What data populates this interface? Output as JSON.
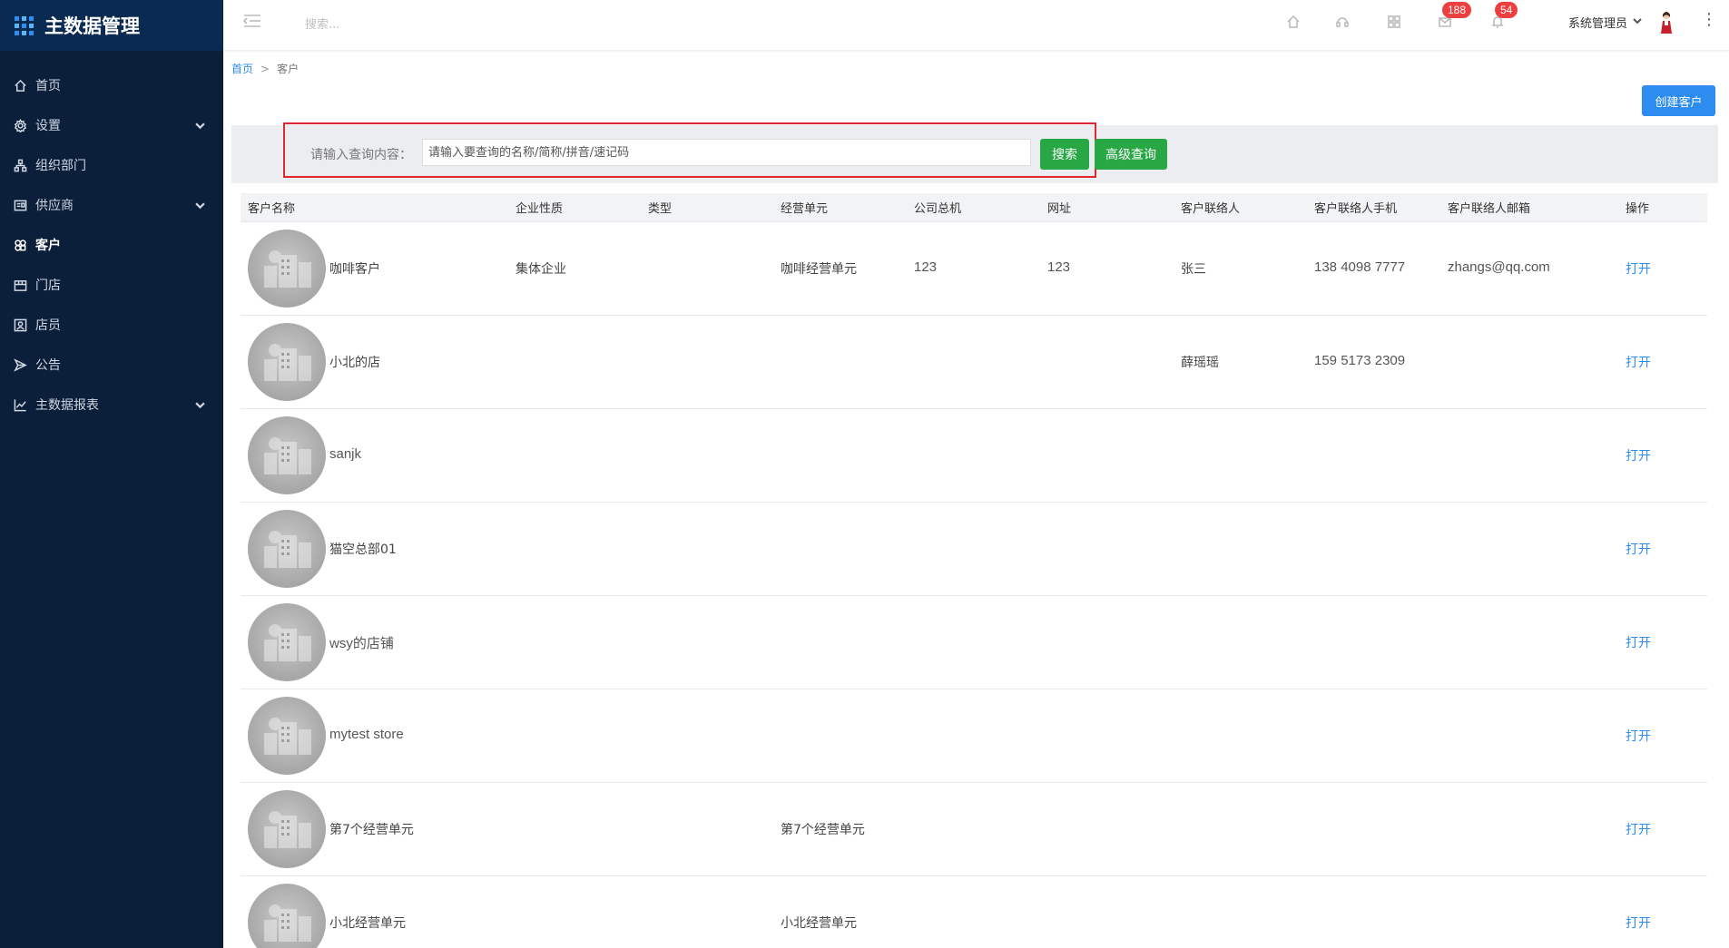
{
  "app": {
    "title": "主数据管理"
  },
  "sidebar": {
    "items": [
      {
        "label": "首页",
        "icon": "home-icon",
        "has_arrow": false,
        "active": false
      },
      {
        "label": "设置",
        "icon": "gear-icon",
        "has_arrow": true,
        "active": false
      },
      {
        "label": "组织部门",
        "icon": "org-chart-icon",
        "has_arrow": false,
        "active": false
      },
      {
        "label": "供应商",
        "icon": "supplier-icon",
        "has_arrow": true,
        "active": false
      },
      {
        "label": "客户",
        "icon": "customer-icon",
        "has_arrow": false,
        "active": true
      },
      {
        "label": "门店",
        "icon": "store-icon",
        "has_arrow": false,
        "active": false
      },
      {
        "label": "店员",
        "icon": "staff-icon",
        "has_arrow": false,
        "active": false
      },
      {
        "label": "公告",
        "icon": "announcement-icon",
        "has_arrow": false,
        "active": false
      },
      {
        "label": "主数据报表",
        "icon": "report-chart-icon",
        "has_arrow": true,
        "active": false
      }
    ]
  },
  "topbar": {
    "search_placeholder": "搜索...",
    "mail_badge": "188",
    "bell_badge": "54",
    "user_name": "系统管理员"
  },
  "breadcrumb": {
    "home": "首页",
    "separator": ">",
    "current": "客户"
  },
  "actions": {
    "create_label": "创建客户"
  },
  "search": {
    "label": "请输入查询内容：",
    "placeholder": "请输入要查询的名称/简称/拼音/速记码",
    "search_label": "搜索",
    "advanced_label": "高级查询"
  },
  "table": {
    "headers": [
      "客户名称",
      "企业性质",
      "类型",
      "经营单元",
      "公司总机",
      "网址",
      "客户联络人",
      "客户联络人手机",
      "客户联络人邮箱",
      "操作"
    ],
    "rows": [
      {
        "name": "咖啡客户",
        "nature": "集体企业",
        "type": "",
        "unit": "咖啡经营单元",
        "phone": "123",
        "website": "123",
        "contact": "张三",
        "mobile": "138 4098 7777",
        "email": "zhangs@qq.com",
        "action": "打开"
      },
      {
        "name": "小北的店",
        "nature": "",
        "type": "",
        "unit": "",
        "phone": "",
        "website": "",
        "contact": "薛瑶瑶",
        "mobile": "159 5173 2309",
        "email": "",
        "action": "打开"
      },
      {
        "name": "sanjk",
        "nature": "",
        "type": "",
        "unit": "",
        "phone": "",
        "website": "",
        "contact": "",
        "mobile": "",
        "email": "",
        "action": "打开"
      },
      {
        "name": "猫空总部01",
        "nature": "",
        "type": "",
        "unit": "",
        "phone": "",
        "website": "",
        "contact": "",
        "mobile": "",
        "email": "",
        "action": "打开"
      },
      {
        "name": "wsy的店铺",
        "nature": "",
        "type": "",
        "unit": "",
        "phone": "",
        "website": "",
        "contact": "",
        "mobile": "",
        "email": "",
        "action": "打开"
      },
      {
        "name": "mytest store",
        "nature": "",
        "type": "",
        "unit": "",
        "phone": "",
        "website": "",
        "contact": "",
        "mobile": "",
        "email": "",
        "action": "打开"
      },
      {
        "name": "第7个经营单元",
        "nature": "",
        "type": "",
        "unit": "第7个经营单元",
        "phone": "",
        "website": "",
        "contact": "",
        "mobile": "",
        "email": "",
        "action": "打开"
      },
      {
        "name": "小北经营单元",
        "nature": "",
        "type": "",
        "unit": "小北经营单元",
        "phone": "",
        "website": "",
        "contact": "",
        "mobile": "",
        "email": "",
        "action": "打开"
      }
    ]
  },
  "colors": {
    "sidebar_bg": "#0c1f3a",
    "sidebar_head_bg": "#0a2a52",
    "primary_blue": "#2d8cf0",
    "success_green": "#28a745",
    "badge_red": "#ed3f3f",
    "highlight_red": "#e0262f"
  }
}
